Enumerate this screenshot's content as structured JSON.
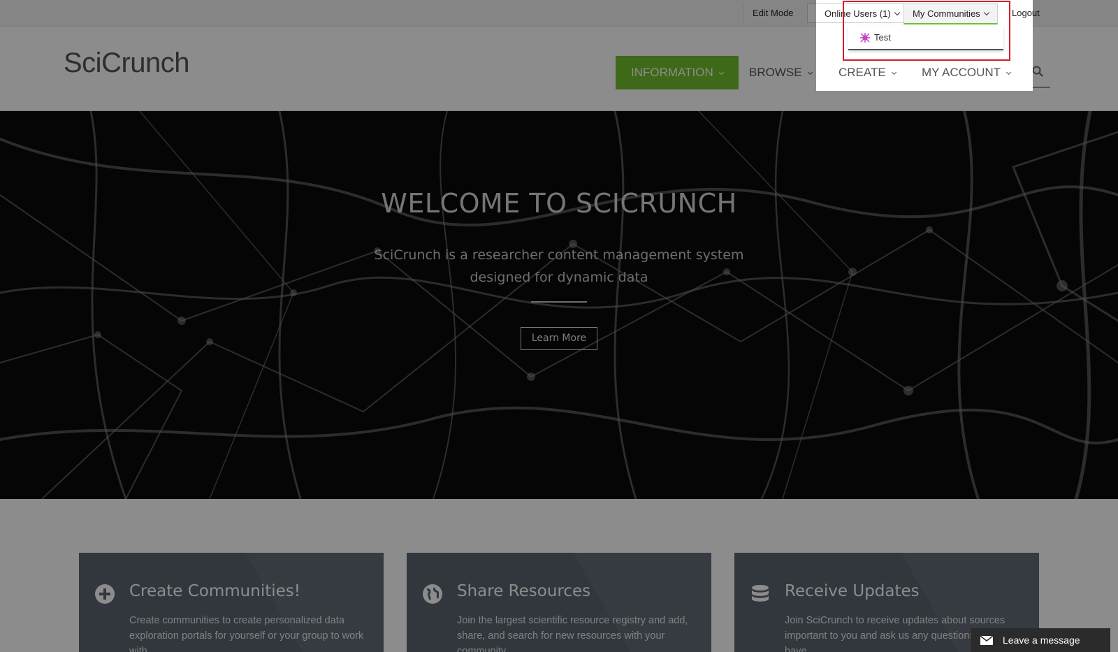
{
  "topbar": {
    "edit_mode": "Edit Mode",
    "online_users": "Online Users (1)",
    "my_communities": "My Communities",
    "logout": "Logout"
  },
  "communities_dropdown": {
    "items": [
      {
        "label": "Test",
        "icon": "community-icon"
      }
    ]
  },
  "header": {
    "logo": "SciCrunch",
    "nav": {
      "information": "INFORMATION",
      "browse": "BROWSE",
      "create": "CREATE",
      "my_account": "MY ACCOUNT"
    },
    "search_icon": "search-icon"
  },
  "hero": {
    "title": "WELCOME TO SCICRUNCH",
    "subtitle": "SciCrunch is a researcher content management system designed for dynamic data",
    "button": "Learn More"
  },
  "features": [
    {
      "icon": "plus-circle-icon",
      "title": "Create Communities!",
      "text": "Create communities to create personalized data exploration portals for yourself or your group to work with."
    },
    {
      "icon": "globe-icon",
      "title": "Share Resources",
      "text": "Join the largest scientific resource registry and add, share, and search for new resources with your community."
    },
    {
      "icon": "database-icon",
      "title": "Receive Updates",
      "text": "Join SciCrunch to receive updates about sources important to you and ask us any questions you might have."
    }
  ],
  "chat": {
    "label": "Leave a message",
    "icon": "envelope-icon"
  },
  "colors": {
    "accent": "#72c02c",
    "highlight": "#d0202a",
    "card": "#5b6570"
  }
}
